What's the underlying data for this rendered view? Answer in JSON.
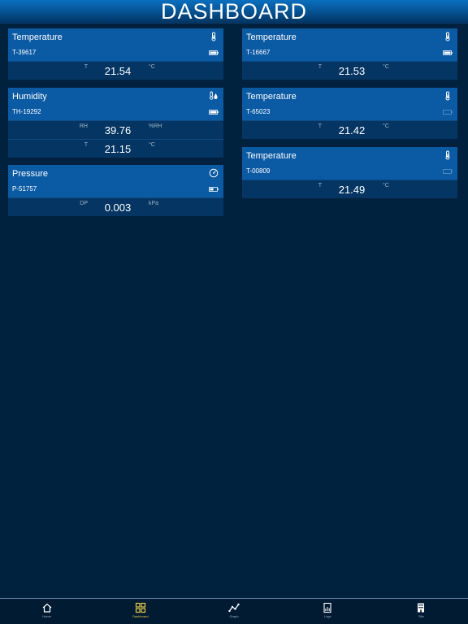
{
  "header": {
    "title": "DASHBOARD"
  },
  "cards": {
    "c1": {
      "title": "Temperature",
      "serial": "T-39617",
      "icon": "thermometer-icon",
      "battery": "full",
      "readings": [
        {
          "label": "T",
          "value": "21.54",
          "unit": "°C"
        }
      ]
    },
    "c2": {
      "title": "Humidity",
      "serial": "TH-19292",
      "icon": "humidity-icon",
      "battery": "full",
      "readings": [
        {
          "label": "RH",
          "value": "39.76",
          "unit": "%RH"
        },
        {
          "label": "T",
          "value": "21.15",
          "unit": "°C"
        }
      ]
    },
    "c3": {
      "title": "Pressure",
      "serial": "P-51757",
      "icon": "gauge-icon",
      "battery": "half",
      "readings": [
        {
          "label": "DP",
          "value": "0.003",
          "unit": "kPa"
        }
      ]
    },
    "c4": {
      "title": "Temperature",
      "serial": "T-16667",
      "icon": "thermometer-icon",
      "battery": "full",
      "readings": [
        {
          "label": "T",
          "value": "21.53",
          "unit": "°C"
        }
      ]
    },
    "c5": {
      "title": "Temperature",
      "serial": "T-65023",
      "icon": "thermometer-icon",
      "battery": "empty",
      "readings": [
        {
          "label": "T",
          "value": "21.42",
          "unit": "°C"
        }
      ]
    },
    "c6": {
      "title": "Temperature",
      "serial": "T-00809",
      "icon": "thermometer-icon",
      "battery": "empty",
      "readings": [
        {
          "label": "T",
          "value": "21.49",
          "unit": "°C"
        }
      ]
    }
  },
  "tabs": [
    {
      "label": "Home",
      "icon": "home-icon",
      "active": false
    },
    {
      "label": "Dashboard",
      "icon": "dashboard-icon",
      "active": true
    },
    {
      "label": "Graph",
      "icon": "graph-icon",
      "active": false
    },
    {
      "label": "Logs",
      "icon": "logs-icon",
      "active": false
    },
    {
      "label": "Site",
      "icon": "building-icon",
      "active": false
    }
  ],
  "colors": {
    "background": "#01223f",
    "card_header": "#0b5aa4",
    "card_body": "#053663",
    "accent_active": "#e8c84a",
    "muted_text": "#9fb3c8"
  }
}
